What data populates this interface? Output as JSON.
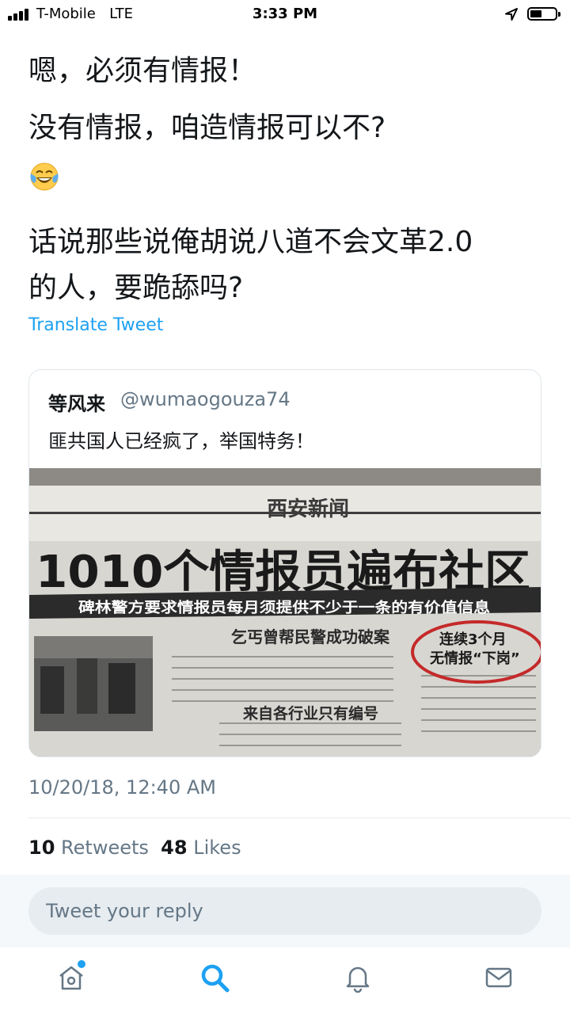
{
  "status_bar": {
    "carrier": "T-Mobile",
    "network": "LTE",
    "time": "3:33 PM"
  },
  "tweet": {
    "lines": [
      "嗯，必须有情报！",
      "没有情报，咱造情报可以不?",
      "话说那些说俺胡说八道不会文革2.0",
      "的人，要跪舔吗?"
    ],
    "emoji": "face-with-tears-of-joy",
    "translate_label": "Translate Tweet",
    "timestamp": "10/20/18, 12:40 AM"
  },
  "quoted_tweet": {
    "name": "等风来",
    "handle": "@wumaogouza74",
    "text": "匪共国人已经疯了，举国特务！",
    "image": {
      "masthead": "西安新闻",
      "headline": "1010个情报员遍布社区",
      "subheadline": "碑林警方要求情报员每月须提供不少于一条的有价值信息",
      "story_title": "乞丐曾帮民警成功破案",
      "story_title_2": "来自各行业只有编号",
      "circled_note_1": "连续3个月",
      "circled_note_2": "无情报“下岗”"
    }
  },
  "stats": {
    "retweets_count": "10",
    "retweets_label": "Retweets",
    "likes_count": "48",
    "likes_label": "Likes"
  },
  "reply": {
    "placeholder": "Tweet your reply"
  },
  "tabbar": {
    "icons": [
      "home-icon",
      "search-icon",
      "notifications-icon",
      "messages-icon"
    ],
    "accent": "#1da1f2"
  }
}
